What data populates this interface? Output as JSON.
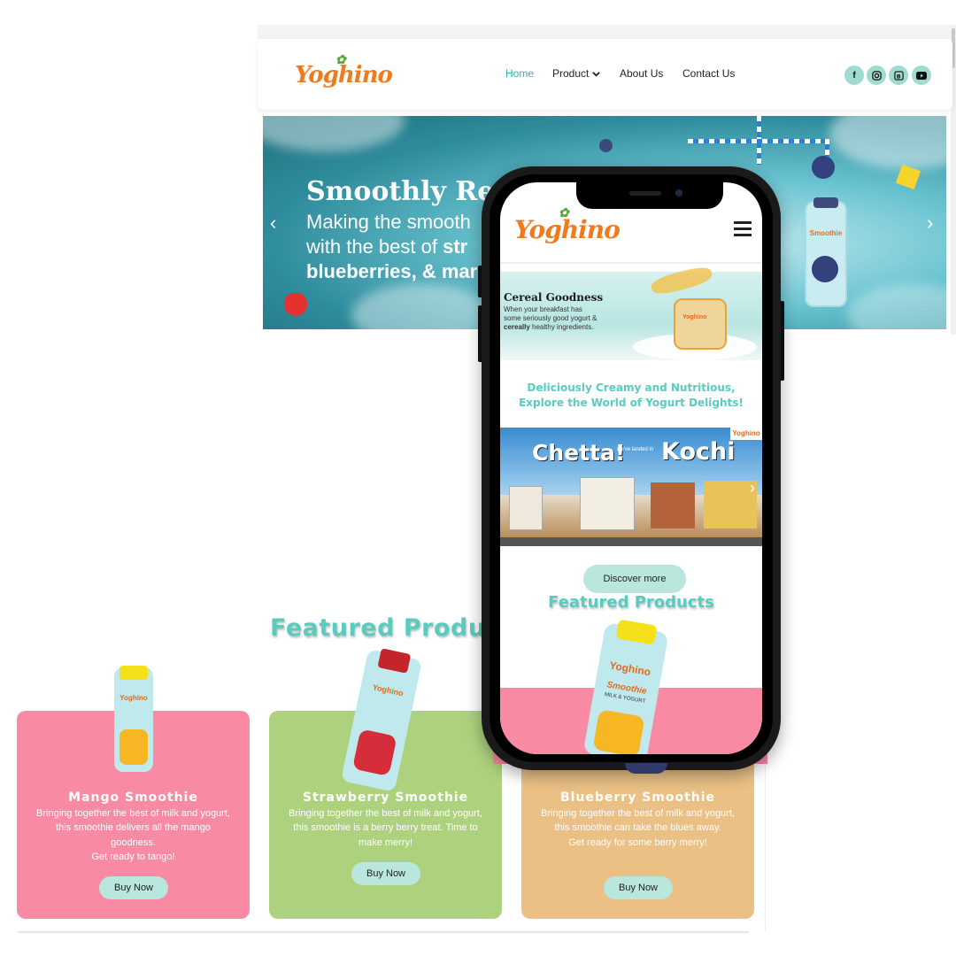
{
  "desktop": {
    "logo_text": "Yoghino",
    "nav": {
      "home": "Home",
      "product": "Product",
      "about": "About Us",
      "contact": "Contact Us"
    },
    "social_icons": [
      "facebook-icon",
      "instagram-icon",
      "behance-icon",
      "youtube-icon"
    ],
    "hero": {
      "title": "Smoothly Refr",
      "line1": "Making the smooth",
      "line2_prefix": "with the best of ",
      "line2_bold": "str",
      "line3": "blueberries, & mar",
      "bottle_label": "Smoothie"
    },
    "featured_title": "Featured Products",
    "products": [
      {
        "name": "Mango Smoothie",
        "desc": "Bringing together the best of milk and yogurt, this smoothie delivers all the mango goodness.",
        "tagline": "Get ready to tango!",
        "button": "Buy Now",
        "color": "#f88ba3"
      },
      {
        "name": "Strawberry Smoothie",
        "desc": "Bringing together the best of milk and yogurt, this smoothie is a berry berry treat. Time to make merry!",
        "tagline": "",
        "button": "Buy Now",
        "color": "#aed17e"
      },
      {
        "name": "Blueberry Smoothie",
        "desc": "Bringing together the best of milk and yogurt, this smoothie can take the blues away.",
        "tagline": "Get ready for some berry merry!",
        "button": "Buy Now",
        "color": "#eac085"
      }
    ]
  },
  "mobile": {
    "logo_text": "Yoghino",
    "banner": {
      "title": "Cereal Goodness",
      "text_line1": "When your breakfast has",
      "text_line2": "some seriously good yogurt &",
      "text_bold": "cereally",
      "text_line3_rest": " healthy ingredients."
    },
    "tagline_line1": "Deliciously Creamy and Nutritious,",
    "tagline_line2": "Explore the World of Yogurt Delights!",
    "kochi": {
      "chetta": "Chetta!",
      "small": "we've landed in",
      "city": "Kochi",
      "badge": "Yoghino"
    },
    "discover_button": "Discover more",
    "featured_title": "Featured Products",
    "bottle_brand": "Yoghino",
    "bottle_label": "Smoothie",
    "bottle_sub": "MILK & YOGURT"
  },
  "colors": {
    "accent": "#59cbbf",
    "brand_orange": "#f07b1f",
    "pink": "#f88ba3",
    "green": "#aed17e",
    "tan": "#eac085"
  }
}
